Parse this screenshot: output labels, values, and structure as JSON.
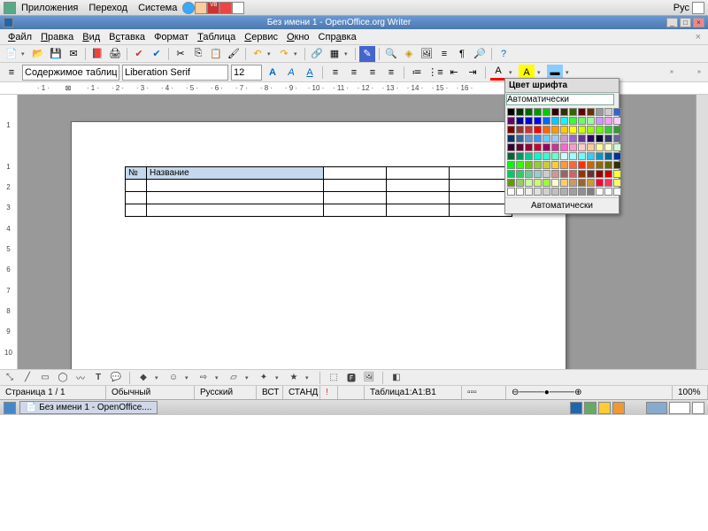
{
  "desktop": {
    "menus": [
      "Приложения",
      "Переход",
      "Система"
    ],
    "lang": "Рус"
  },
  "window": {
    "title": "Без имени 1 - OpenOffice.org Writer",
    "min": "_",
    "max": "□",
    "close": "×"
  },
  "menubar": {
    "items": [
      {
        "label": "Файл",
        "u": 0
      },
      {
        "label": "Правка",
        "u": 0
      },
      {
        "label": "Вид",
        "u": 0
      },
      {
        "label": "Вставка",
        "u": 1
      },
      {
        "label": "Формат",
        "u": -1
      },
      {
        "label": "Таблица",
        "u": 0
      },
      {
        "label": "Сервис",
        "u": 0
      },
      {
        "label": "Окно",
        "u": 0
      },
      {
        "label": "Справка",
        "u": 3
      }
    ]
  },
  "format": {
    "style": "Содержимое таблицы",
    "font": "Liberation Serif",
    "size": "12"
  },
  "ruler_h": [
    "1",
    "",
    "1",
    "2",
    "3",
    "4",
    "5",
    "6",
    "7",
    "8",
    "9",
    "10",
    "11",
    "12",
    "13",
    "14",
    "15",
    "16"
  ],
  "ruler_v": [
    "1",
    "",
    "1",
    "2",
    "3",
    "4",
    "5",
    "6",
    "7",
    "8",
    "9",
    "10"
  ],
  "table": {
    "headers": [
      "№",
      "Название"
    ],
    "rows": 4,
    "cols": 5
  },
  "color_popup": {
    "title": "Цвет шрифта",
    "auto_label": "Автоматически",
    "colors": [
      "#000000",
      "#003300",
      "#006600",
      "#009900",
      "#00cc00",
      "#330000",
      "#333300",
      "#336600",
      "#660000",
      "#663300",
      "#999999",
      "#cccccc",
      "#3366cc",
      "#660066",
      "#000099",
      "#0000cc",
      "#0000ff",
      "#0066ff",
      "#00ccff",
      "#00ffff",
      "#33ff33",
      "#66ff66",
      "#99ff99",
      "#cc99ff",
      "#ff99ff",
      "#ffccff",
      "#800000",
      "#993333",
      "#cc3333",
      "#ff0000",
      "#ff6600",
      "#ff9900",
      "#ffcc00",
      "#ffff00",
      "#ccff00",
      "#99ff00",
      "#66ff00",
      "#33cc33",
      "#339933",
      "#003366",
      "#336699",
      "#6699cc",
      "#3399ff",
      "#66ccff",
      "#99ccff",
      "#cc99cc",
      "#9966cc",
      "#663399",
      "#330066",
      "#000033",
      "#333366",
      "#666699",
      "#330033",
      "#660033",
      "#990033",
      "#cc0033",
      "#990066",
      "#cc3399",
      "#ff66cc",
      "#ff99cc",
      "#ffcccc",
      "#ffcc99",
      "#ffff99",
      "#ffffcc",
      "#ccffcc",
      "#006633",
      "#009966",
      "#00cc99",
      "#00ffcc",
      "#33ffcc",
      "#66ffcc",
      "#ccffff",
      "#99ffff",
      "#66ffff",
      "#33ccff",
      "#0099cc",
      "#006699",
      "#003399",
      "#00ff00",
      "#33ff00",
      "#66cc00",
      "#99cc33",
      "#cccc33",
      "#ffcc33",
      "#ff9933",
      "#ff6633",
      "#ff3300",
      "#cc6600",
      "#996600",
      "#666600",
      "#333300",
      "#00cc66",
      "#33cc66",
      "#66cc99",
      "#99cccc",
      "#cccccc",
      "#cc9999",
      "#996666",
      "#cc6666",
      "#993300",
      "#663333",
      "#990000",
      "#cc0000",
      "#ffff33",
      "#669900",
      "#99cc66",
      "#ccff99",
      "#ccff66",
      "#99ff33",
      "#ffffcc",
      "#ffcc66",
      "#cc9966",
      "#996633",
      "#cc9933",
      "#ff0033",
      "#ff3366",
      "#ffff66",
      "#ffffff",
      "#ffffff",
      "#f0f0f0",
      "#e0e0e0",
      "#d0d0d0",
      "#c0c0c0",
      "#b0b0b0",
      "#a0a0a0",
      "#909090",
      "#808080",
      "#ffffff",
      "#ffffff",
      "#ffffff"
    ]
  },
  "status": {
    "page": "Страница 1 / 1",
    "style": "Обычный",
    "lang": "Русский",
    "ins": "ВСТ",
    "std": "СТАНД",
    "table_ref": "Таблица1:A1:B1",
    "zoom": "100%"
  },
  "taskbar": {
    "app": "Без имени 1 - OpenOffice...."
  }
}
